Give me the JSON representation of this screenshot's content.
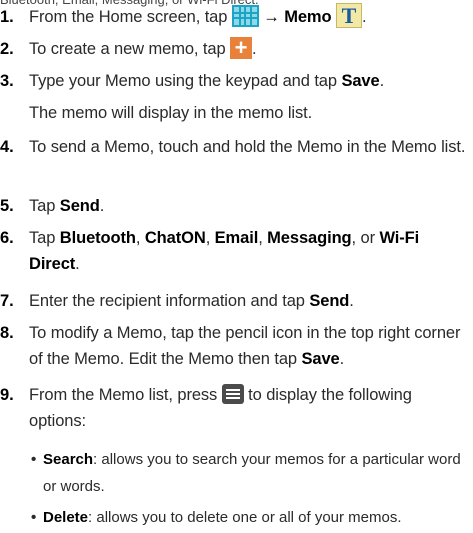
{
  "steps": [
    {
      "num": "1.",
      "p1": "From the Home screen, tap ",
      "arrow": " → ",
      "memo_label": "Memo",
      "icons": [
        "apps-grid-icon",
        "memo-app-icon"
      ]
    },
    {
      "num": "2.",
      "p1": "To create a new memo, tap ",
      "p2": ".",
      "icons": [
        "add-icon"
      ]
    },
    {
      "num": "3.",
      "p1": "Type your Memo using the keypad and tap ",
      "save": "Save",
      "p2": ".",
      "line2": "The memo will display in the memo list."
    },
    {
      "num": "4.",
      "text": "To send a Memo, touch and hold the Memo in the Memo list."
    },
    {
      "num": "5.",
      "p1": "Tap ",
      "send": "Send",
      "p2": "."
    },
    {
      "num": "6.",
      "p1": "Tap ",
      "bluetooth": "Bluetooth",
      "c1": ", ",
      "chaton": "ChatON",
      "c2": ", ",
      "email": "Email",
      "c3": ", ",
      "messaging": "Messaging",
      "c4": ", or ",
      "wifi": "Wi-Fi Direct",
      "p2": "."
    },
    {
      "num": "7.",
      "p1": "Enter the recipient information and tap ",
      "send": "Send",
      "p2": "."
    },
    {
      "num": "8.",
      "p1": "To modify a Memo, tap the pencil icon in the top right corner of the Memo. Edit the Memo then tap ",
      "save": "Save",
      "p2": "."
    },
    {
      "num": "9.",
      "p1": "From the Memo list, press ",
      "p2": " to display the following options:",
      "icons": [
        "menu-icon"
      ]
    }
  ],
  "bullets": [
    {
      "term": "Search",
      "text": ": allows you to search your memos for a particular word or words."
    },
    {
      "term": "Delete",
      "text": ": allows you to delete one or all of your memos."
    }
  ],
  "cut_line_text": "Bluetooth, Email, Messaging, or Wi-Fi Direct."
}
